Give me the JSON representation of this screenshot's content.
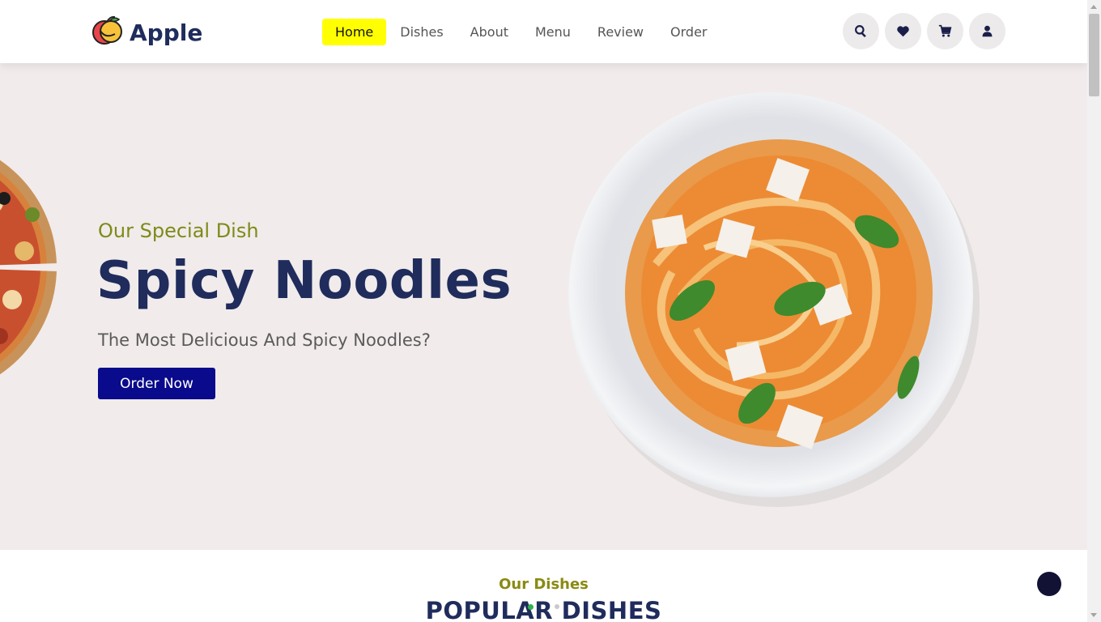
{
  "brand": {
    "name": "Apple",
    "logo_icon": "apple-logo-icon"
  },
  "nav": {
    "items": [
      {
        "label": "Home",
        "active": true
      },
      {
        "label": "Dishes",
        "active": false
      },
      {
        "label": "About",
        "active": false
      },
      {
        "label": "Menu",
        "active": false
      },
      {
        "label": "Review",
        "active": false
      },
      {
        "label": "Order",
        "active": false
      }
    ],
    "active_color": "#ffff00"
  },
  "header_icons": [
    "search-icon",
    "heart-icon",
    "cart-icon",
    "user-icon"
  ],
  "hero": {
    "subtitle": "Our Special Dish",
    "title": "Spicy Noodles",
    "description": "The Most Delicious And Spicy Noodles?",
    "cta_label": "Order Now",
    "image": "spaghetti-plate-image"
  },
  "dishes_section": {
    "subtitle": "Our Dishes",
    "title": "POPULAR DISHES"
  },
  "colors": {
    "primary": "#1f2c5c",
    "accent_olive": "#7f8a17",
    "button": "#0a0a8c",
    "hero_bg": "#f1ebeb"
  }
}
